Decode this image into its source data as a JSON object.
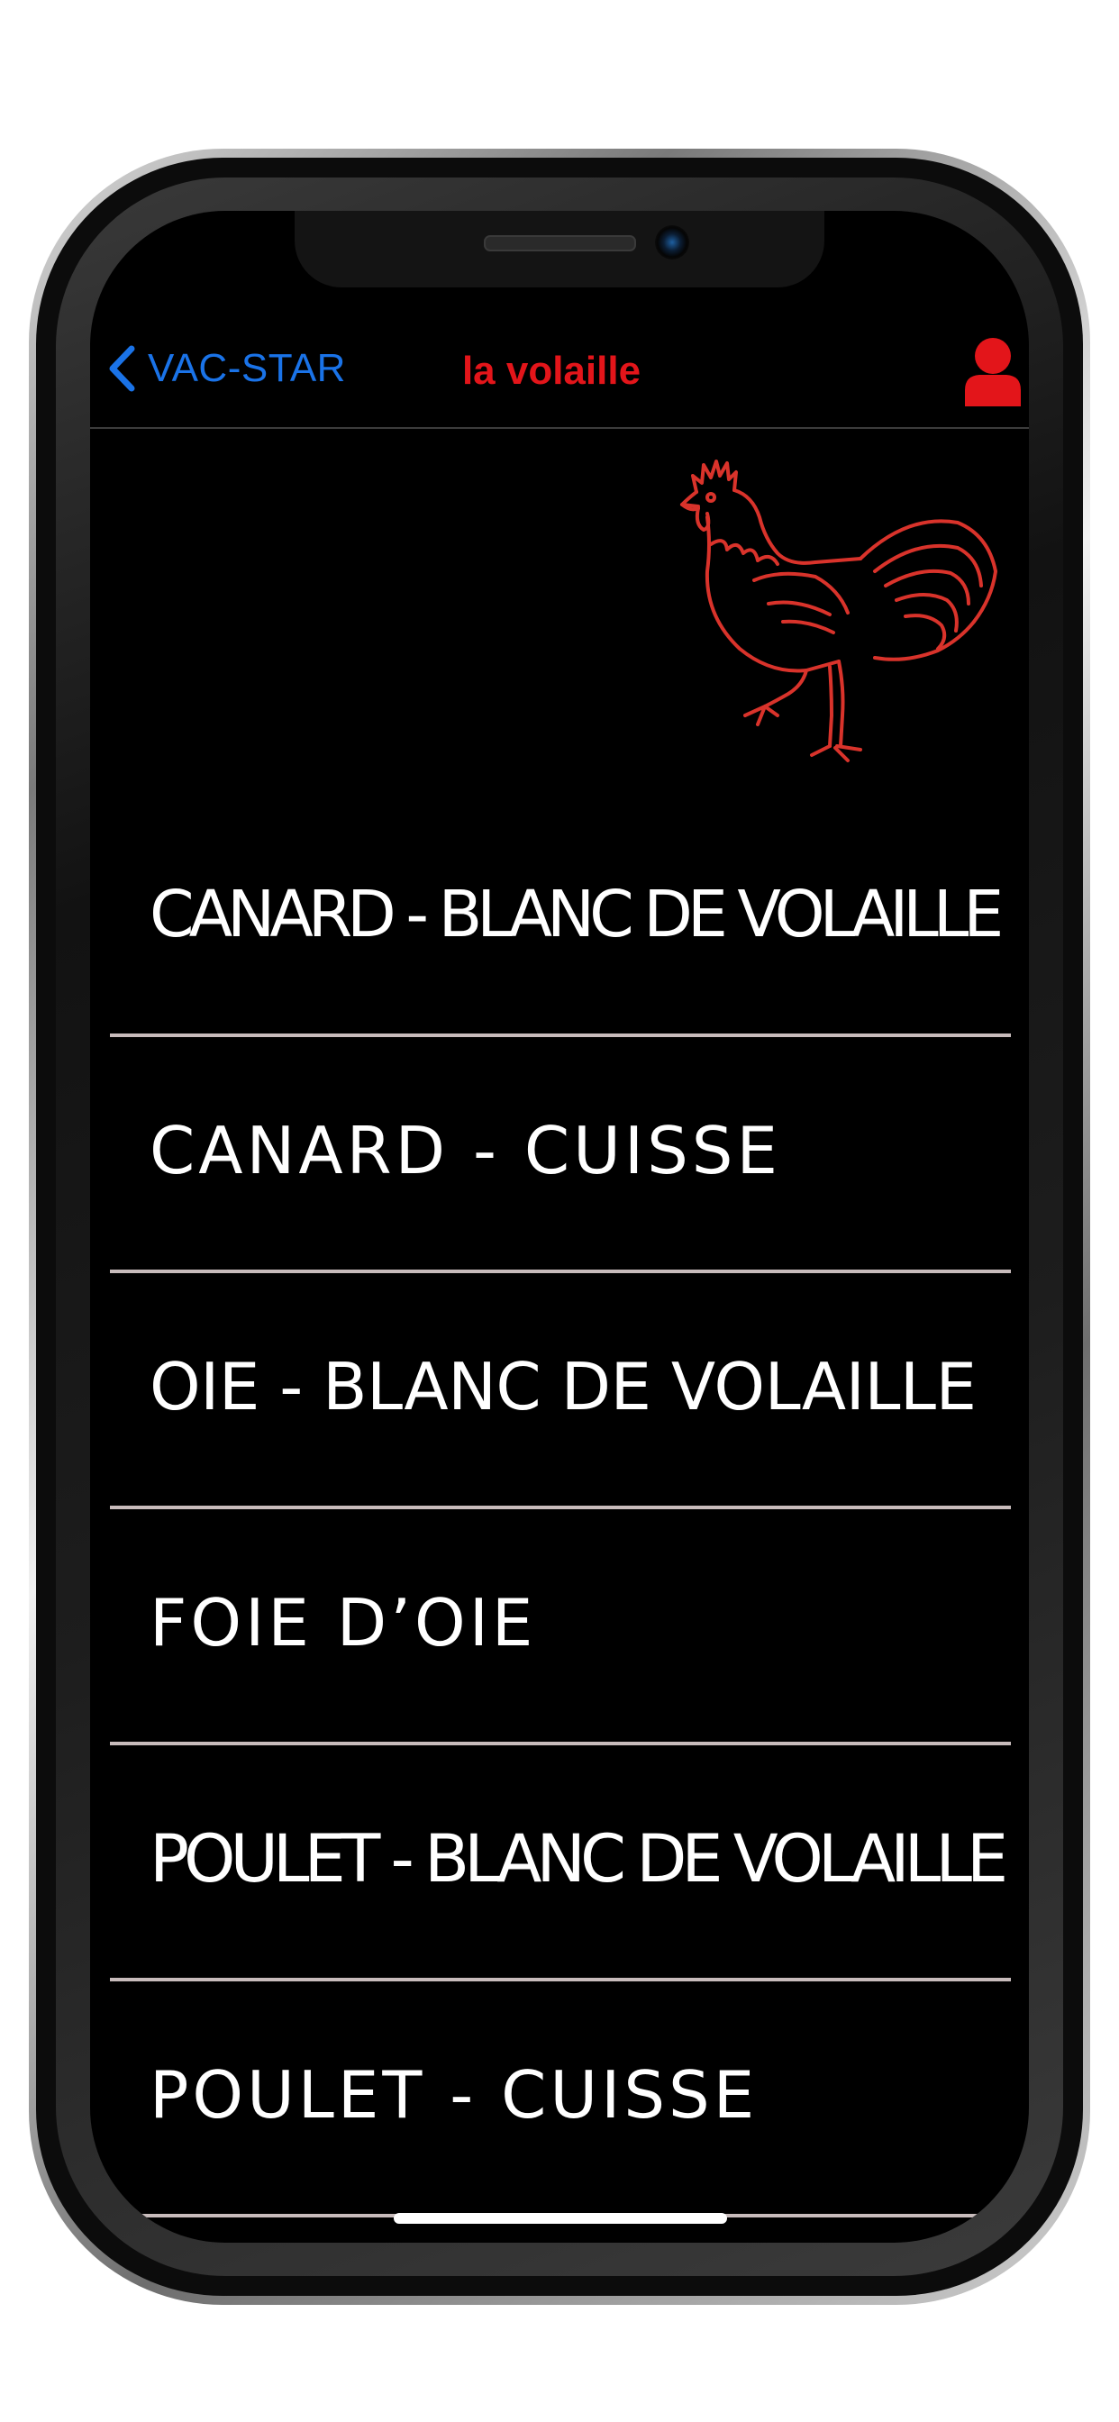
{
  "navbar": {
    "back_label": "VAC-STAR",
    "title": "la volaille",
    "back_icon": "chevron-left-icon",
    "profile_icon": "user-icon"
  },
  "colors": {
    "accent_blue": "#1a73e8",
    "accent_red": "#e3151a",
    "background": "#000000",
    "list_text": "#ffffff",
    "divider": "#c8bcbc"
  },
  "hero": {
    "icon": "rooster-icon"
  },
  "items": [
    {
      "label": "CANARD - BLANC DE VOLAILLE"
    },
    {
      "label": "CANARD - CUISSE"
    },
    {
      "label": "OIE - BLANC DE VOLAILLE"
    },
    {
      "label": "FOIE D’OIE"
    },
    {
      "label": "POULET - BLANC DE VOLAILLE"
    },
    {
      "label": "POULET - CUISSE"
    }
  ]
}
